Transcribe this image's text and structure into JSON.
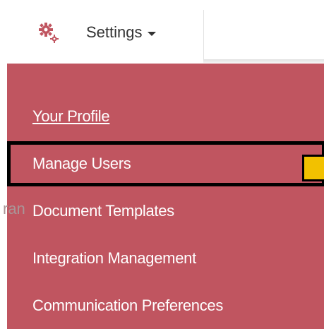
{
  "nav": {
    "settings_label": "Settings"
  },
  "menu": {
    "items": [
      {
        "label": "Your Profile"
      },
      {
        "label": "Manage Users"
      },
      {
        "label": "Document Templates"
      },
      {
        "label": "Integration Management"
      },
      {
        "label": "Communication Preferences"
      }
    ]
  },
  "background": {
    "partial_text": "ran"
  },
  "colors": {
    "menu_bg": "#c05560",
    "menu_text": "#ffffff",
    "highlight_border": "#000000",
    "marker": "#f2c100",
    "gear": "#c05560"
  },
  "icons": {
    "settings": "gear-icon",
    "dropdown": "caret-down-icon"
  }
}
